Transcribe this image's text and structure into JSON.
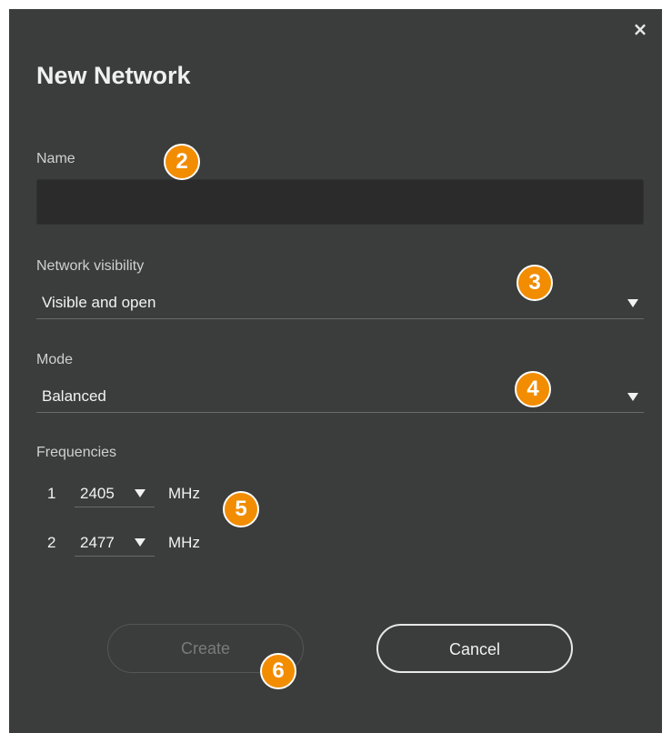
{
  "dialog": {
    "title": "New Network",
    "close_icon": "×"
  },
  "name_field": {
    "label": "Name",
    "value": "",
    "placeholder": ""
  },
  "visibility": {
    "label": "Network visibility",
    "selected": "Visible and open"
  },
  "mode": {
    "label": "Mode",
    "selected": "Balanced"
  },
  "frequencies": {
    "label": "Frequencies",
    "unit": "MHz",
    "items": [
      {
        "index": "1",
        "value": "2405"
      },
      {
        "index": "2",
        "value": "2477"
      }
    ]
  },
  "buttons": {
    "create": "Create",
    "cancel": "Cancel"
  },
  "callouts": [
    "2",
    "3",
    "4",
    "5",
    "6"
  ],
  "colors": {
    "dialog_bg": "#3b3c3c",
    "input_bg": "#2b2b2b",
    "callout": "#f28c00"
  }
}
